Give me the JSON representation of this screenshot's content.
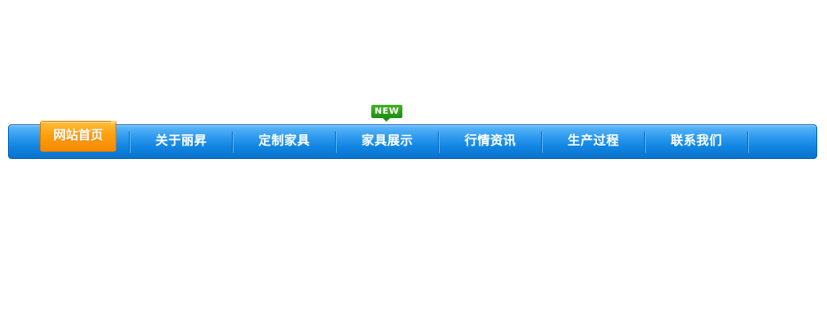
{
  "nav": {
    "home": "网站首页",
    "items": [
      {
        "label": "关于丽昇"
      },
      {
        "label": "定制家具"
      },
      {
        "label": "家具展示"
      },
      {
        "label": "行情资讯"
      },
      {
        "label": "生产过程"
      },
      {
        "label": "联系我们"
      }
    ],
    "new_badge": "NEW"
  },
  "colors": {
    "nav_blue": "#1185e2",
    "home_orange": "#ff9f0f",
    "badge_green": "#2a9a1a"
  }
}
